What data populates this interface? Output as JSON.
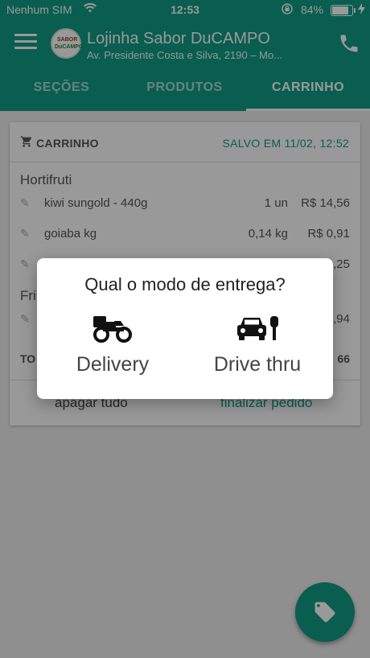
{
  "status_bar": {
    "carrier": "Nenhum SIM",
    "time": "12:53",
    "battery_percent": "84%",
    "battery_level": 0.84
  },
  "app_bar": {
    "title": "Lojinha Sabor DuCAMPO",
    "subtitle": "Av. Presidente Costa e Silva, 2190 – Mo...",
    "logo_text_top": "SABOR",
    "logo_text_bottom": "DuCAMPO"
  },
  "tabs": [
    {
      "label": "SEÇÕES",
      "active": false
    },
    {
      "label": "PRODUTOS",
      "active": false
    },
    {
      "label": "CARRINHO",
      "active": true
    }
  ],
  "cart": {
    "header_title": "CARRINHO",
    "saved_text": "SALVO EM 11/02, 12:52",
    "sections": [
      {
        "title": "Hortifruti",
        "items": [
          {
            "name": "kiwi sungold - 440g",
            "qty": "1 un",
            "price": "R$ 14,56"
          },
          {
            "name": "goiaba kg",
            "qty": "0,14 kg",
            "price": "R$ 0,91"
          },
          {
            "name": "",
            "qty": "",
            "price": ",25"
          }
        ]
      },
      {
        "title": "Fri",
        "items": [
          {
            "name": "",
            "qty": "",
            "price": ",94"
          }
        ]
      }
    ],
    "total_label": "TO",
    "total_value": "66",
    "clear_button": "apagar tudo",
    "finish_button": "finalizar pedido"
  },
  "dialog": {
    "title": "Qual o modo de entrega?",
    "options": [
      {
        "label": "Delivery",
        "icon": "motorcycle-icon"
      },
      {
        "label": "Drive thru",
        "icon": "car-pump-icon"
      }
    ]
  },
  "colors": {
    "primary": "#0f9d86",
    "overlay": "rgba(0,0,0,0.40)"
  }
}
